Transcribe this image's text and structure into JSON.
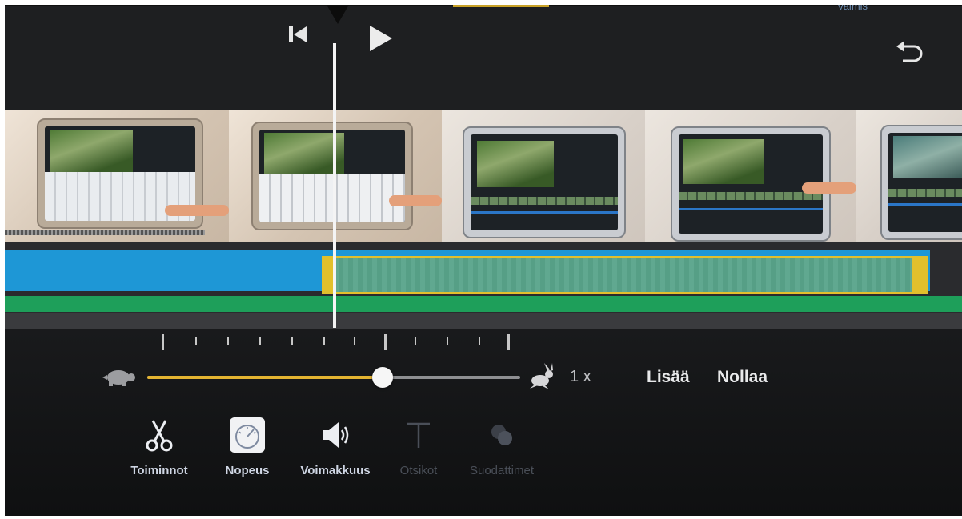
{
  "toolbar": {
    "done_label": "Valmis",
    "play_label": "Play",
    "skip_back_label": "Skip to start"
  },
  "speed": {
    "rate_label": "1 x",
    "slider_value": 0.63,
    "add_label": "Lisää",
    "reset_label": "Nollaa"
  },
  "tools": [
    {
      "label": "Toiminnot",
      "icon": "scissors-icon",
      "active": false,
      "enabled": true
    },
    {
      "label": "Nopeus",
      "icon": "speedometer-icon",
      "active": true,
      "enabled": true
    },
    {
      "label": "Voimakkuus",
      "icon": "speaker-icon",
      "active": false,
      "enabled": true
    },
    {
      "label": "Otsikot",
      "icon": "title-t-icon",
      "active": false,
      "enabled": false
    },
    {
      "label": "Suodattimet",
      "icon": "filters-icon",
      "active": false,
      "enabled": false
    }
  ],
  "colors": {
    "accent": "#e4b431",
    "track_blue": "#1e97d6",
    "track_green": "#1e9f5a",
    "clip_selected": "#5aa58b"
  }
}
